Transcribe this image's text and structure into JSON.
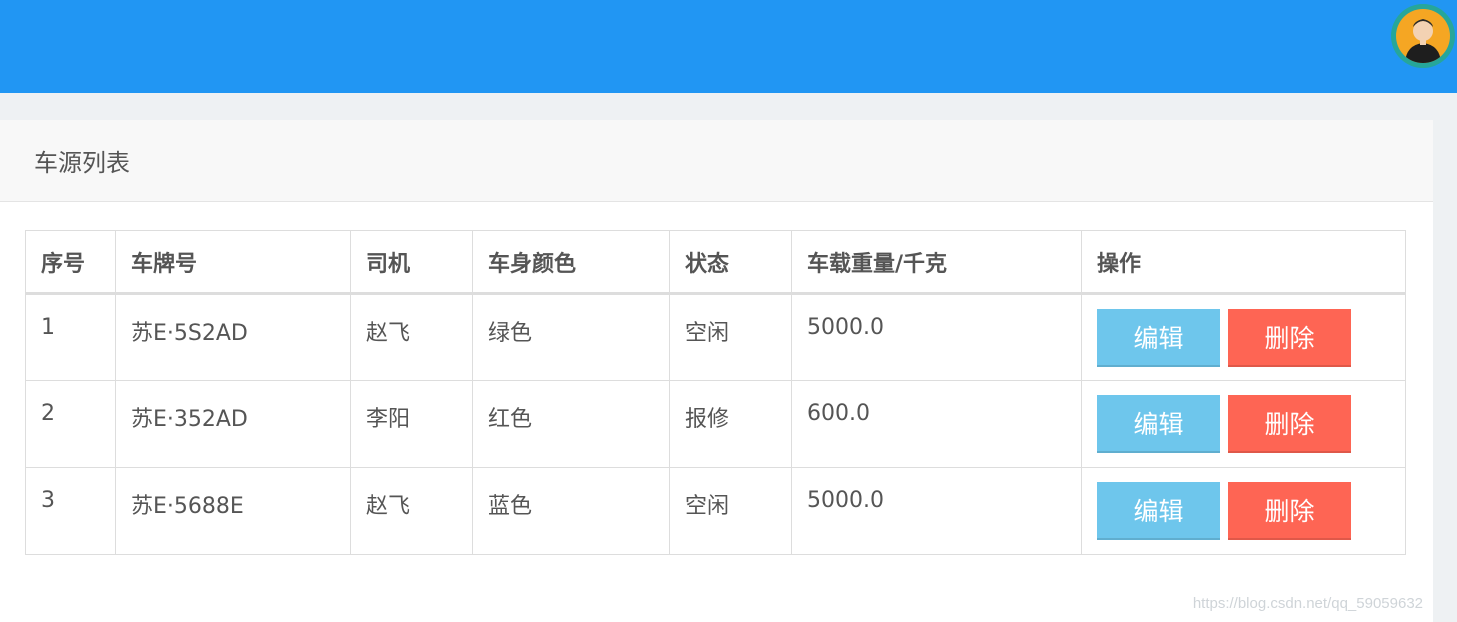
{
  "panel": {
    "title": "车源列表"
  },
  "table": {
    "headers": [
      "序号",
      "车牌号",
      "司机",
      "车身颜色",
      "状态",
      "车载重量/千克",
      "操作"
    ],
    "rows": [
      {
        "index": "1",
        "plate": "苏E·5S2AD",
        "driver": "赵飞",
        "color": "绿色",
        "status": "空闲",
        "weight": "5000.0"
      },
      {
        "index": "2",
        "plate": "苏E·352AD",
        "driver": "李阳",
        "color": "红色",
        "status": "报修",
        "weight": "600.0"
      },
      {
        "index": "3",
        "plate": "苏E·5688E",
        "driver": "赵飞",
        "color": "蓝色",
        "status": "空闲",
        "weight": "5000.0"
      }
    ],
    "actions": {
      "edit_label": "编辑",
      "delete_label": "删除"
    }
  },
  "colors": {
    "topbar": "#2196f3",
    "edit": "#6ec6ec",
    "delete": "#fe6554"
  },
  "watermark": "https://blog.csdn.net/qq_59059632"
}
